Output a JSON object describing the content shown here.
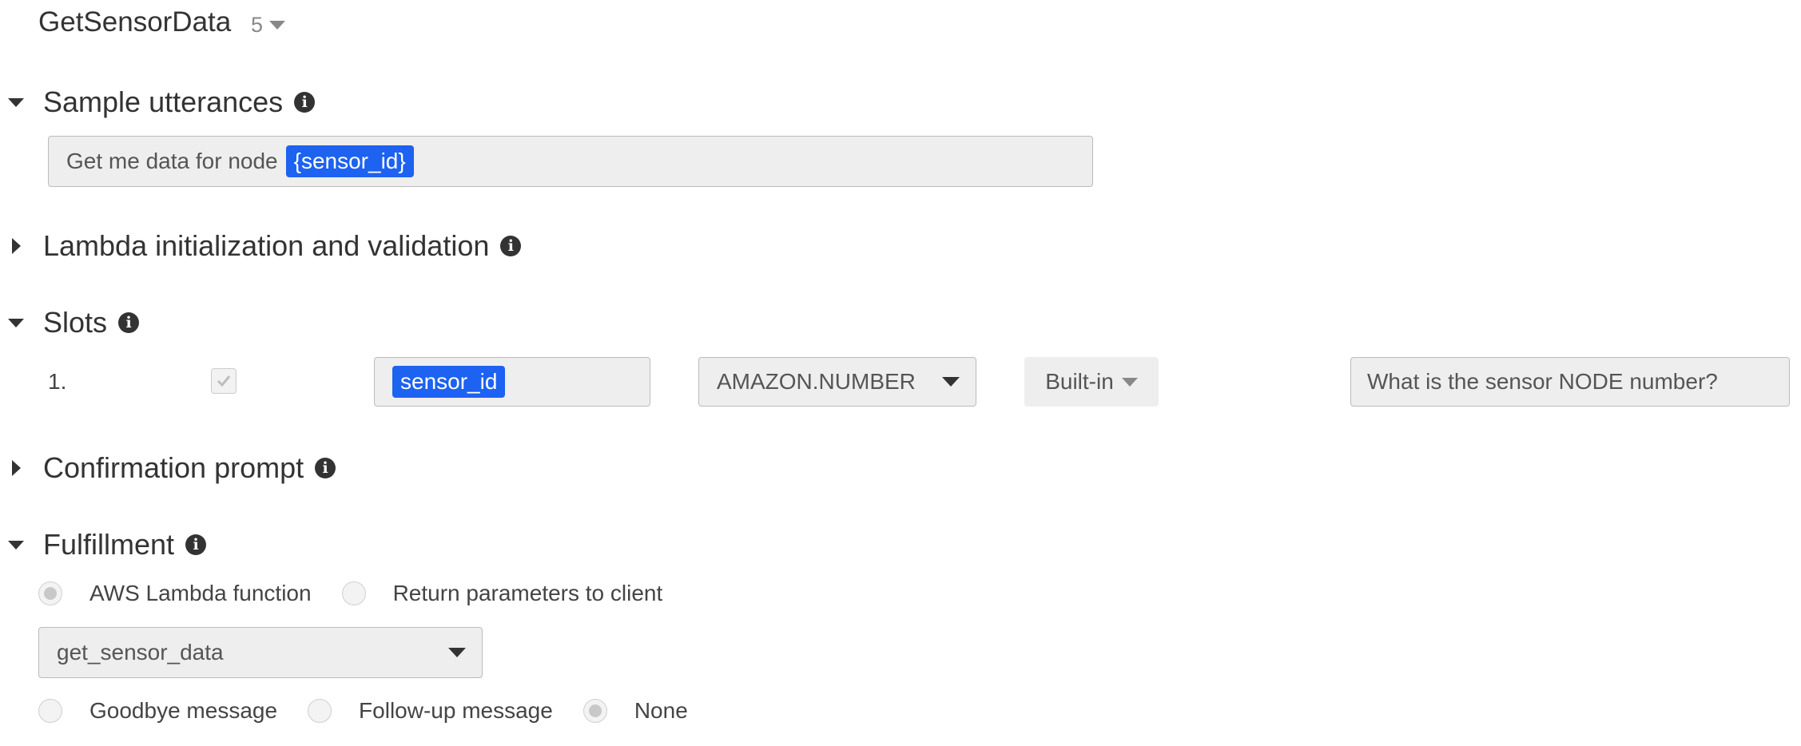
{
  "intent": {
    "name": "GetSensorData",
    "version": "5"
  },
  "sections": {
    "sample_utterances": {
      "label": "Sample utterances",
      "utterance_text": "Get me data for node",
      "utterance_slot": "{sensor_id}"
    },
    "lambda_init": {
      "label": "Lambda initialization and validation"
    },
    "slots": {
      "label": "Slots",
      "rows": [
        {
          "index": "1.",
          "name": "sensor_id",
          "type": "AMAZON.NUMBER",
          "source": "Built-in",
          "prompt": "What is the sensor NODE number?"
        }
      ]
    },
    "confirmation": {
      "label": "Confirmation prompt"
    },
    "fulfillment": {
      "label": "Fulfillment",
      "option_lambda": "AWS Lambda function",
      "option_return": "Return parameters to client",
      "selected_option": "AWS Lambda function",
      "lambda_function": "get_sensor_data",
      "message_goodbye": "Goodbye message",
      "message_followup": "Follow-up message",
      "message_none": "None",
      "selected_message": "None"
    }
  }
}
